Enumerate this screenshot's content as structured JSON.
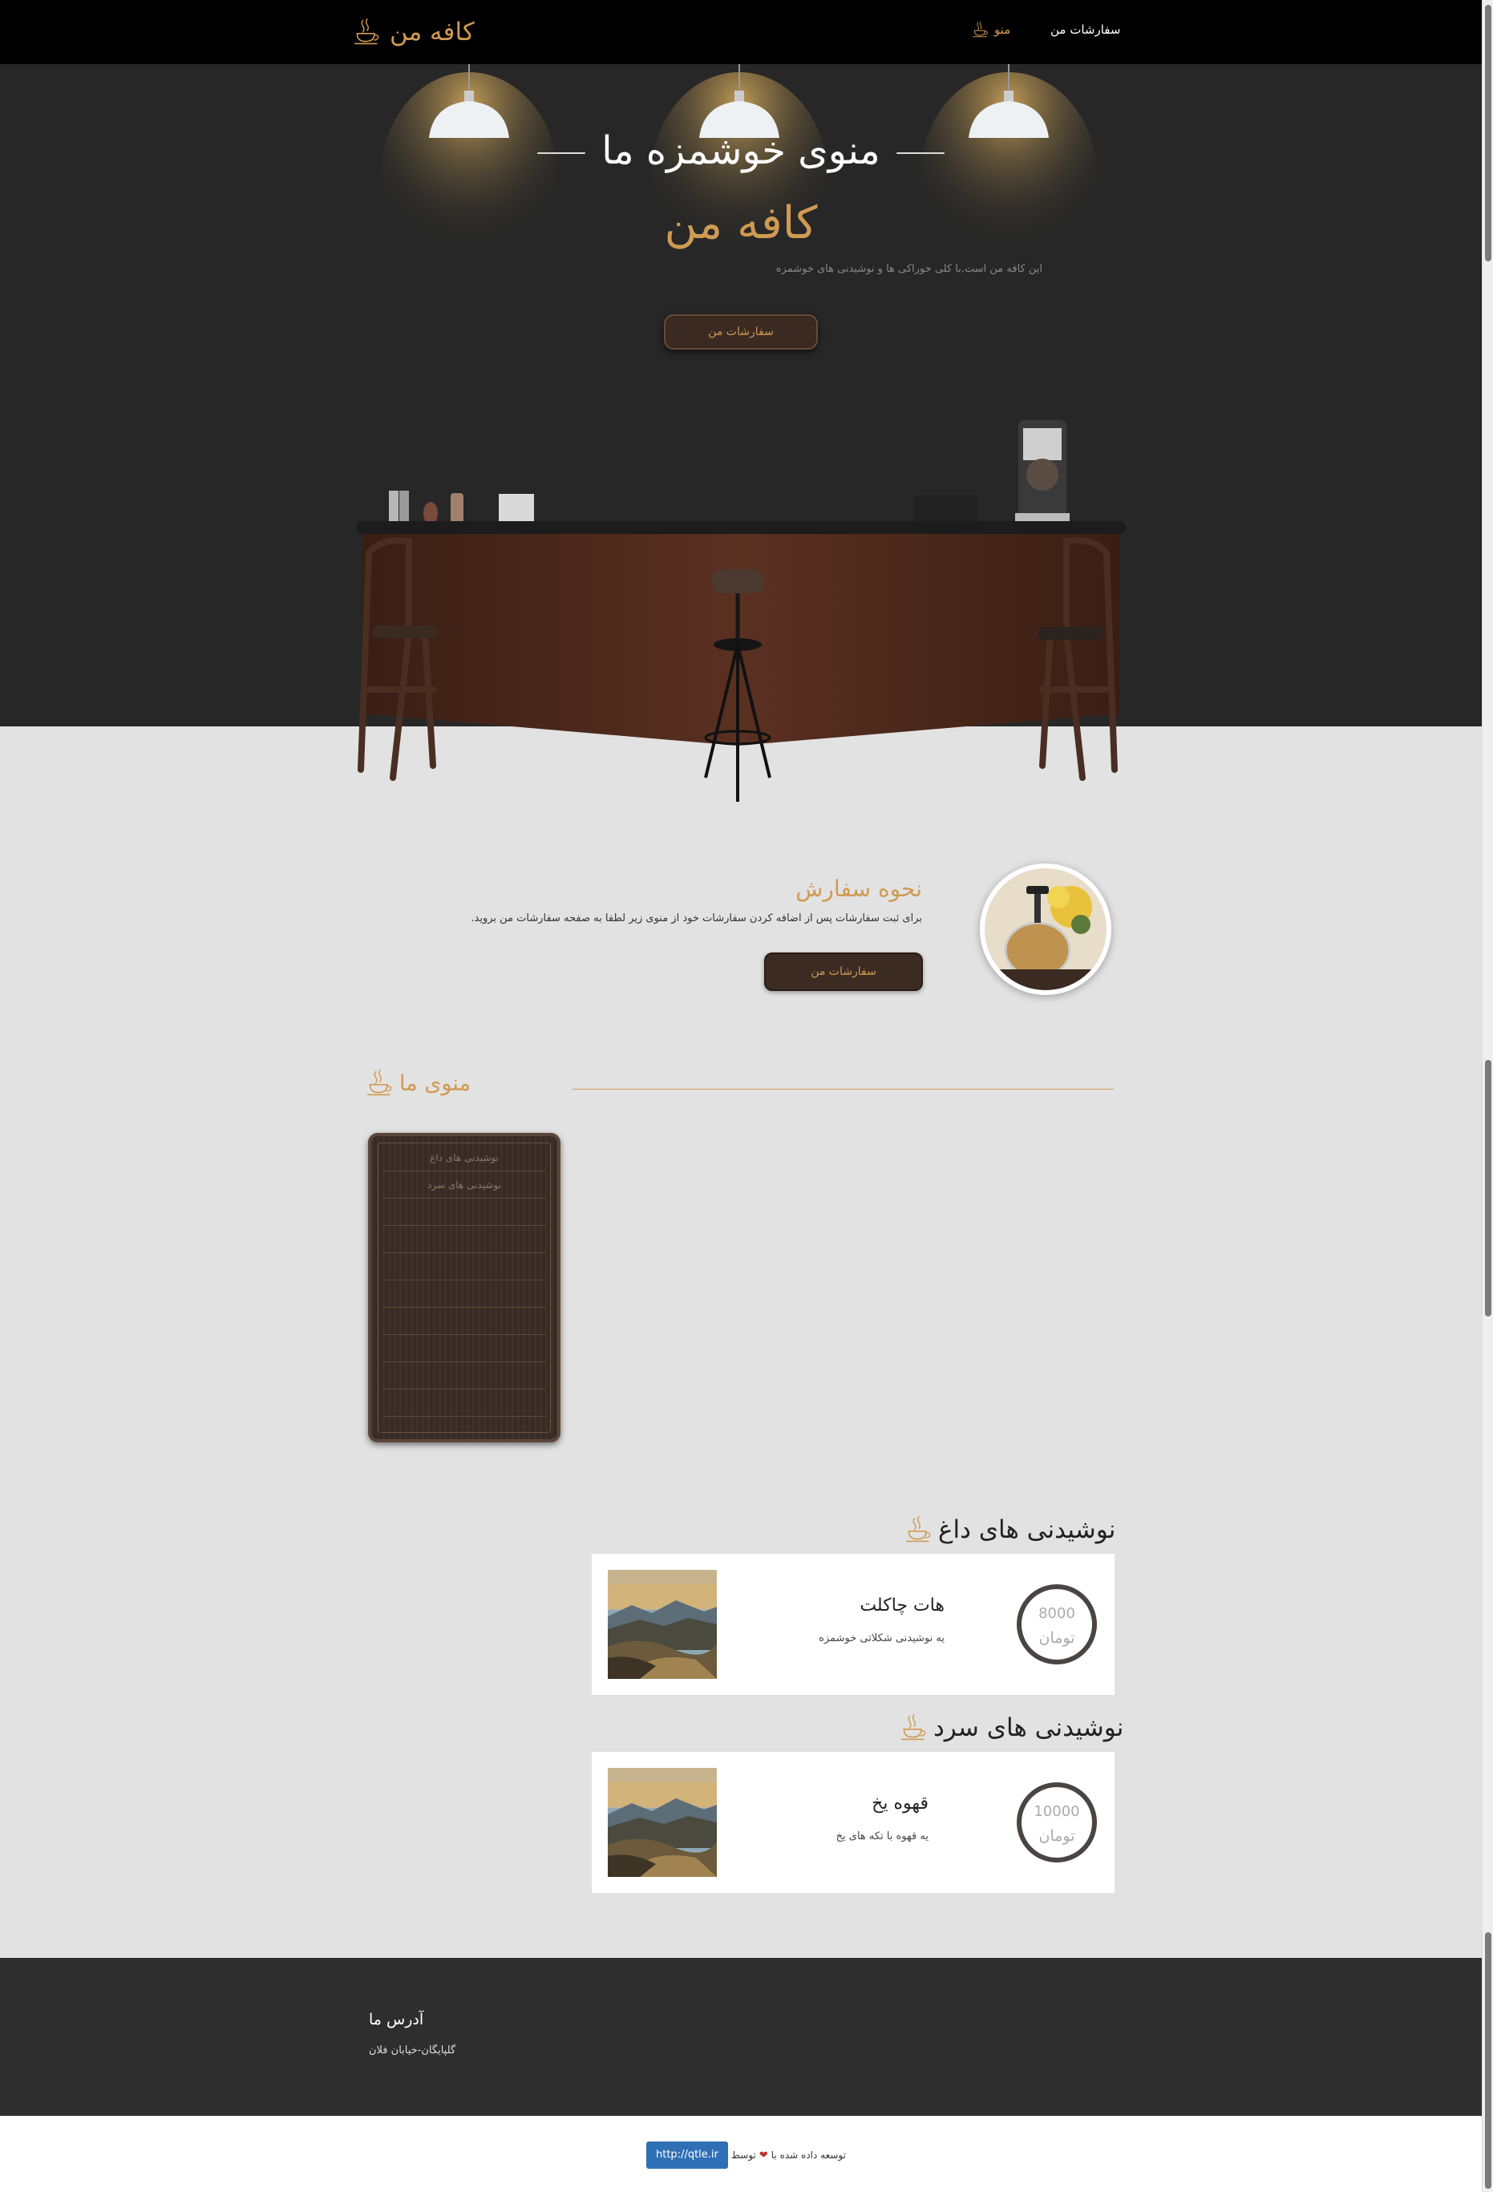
{
  "navbar": {
    "brand": "کافه من",
    "links": [
      {
        "label": "سفارشات من"
      },
      {
        "label": "منو"
      }
    ]
  },
  "hero": {
    "title": "منوی خوشمزه ما",
    "brand": "کافه من",
    "description": "این کافه من است.با کلی خوراکی ها و نوشیدنی های خوشمزه",
    "button": "سفارشات من"
  },
  "howto": {
    "title": "نحوه سفارش",
    "description": "برای ثبت سفارشات پس از اضافه کردن سفارشات خود از منوی زیر لطفا به صفحه سفارشات من بروید.",
    "button": "سفارشات من"
  },
  "menu": {
    "heading": "منوی ما",
    "board_items": [
      "نوشیدنی های داغ",
      "نوشیدنی های سرد"
    ]
  },
  "categories": [
    {
      "title": "نوشیدنی های داغ",
      "items": [
        {
          "name": "هات چاکلت",
          "description": "یه نوشیدنی شکلاتی خوشمزه",
          "price": "8000",
          "currency": "تومان"
        }
      ]
    },
    {
      "title": "نوشیدنی های سرد",
      "items": [
        {
          "name": "قهوه یخ",
          "description": "یه قهوه با تکه های یخ",
          "price": "10000",
          "currency": "تومان"
        }
      ]
    }
  ],
  "footer": {
    "title": "آدرس ما",
    "address": "گلپایگان-خیابان فلان",
    "credit_text": "توسعه داده شده با",
    "credit_by": "توسط",
    "credit_link": "http://qtle.ir"
  },
  "icons": {
    "brand": "coffee-cup-icon",
    "heart": "heart-icon",
    "accent_color": "#d09a53"
  }
}
